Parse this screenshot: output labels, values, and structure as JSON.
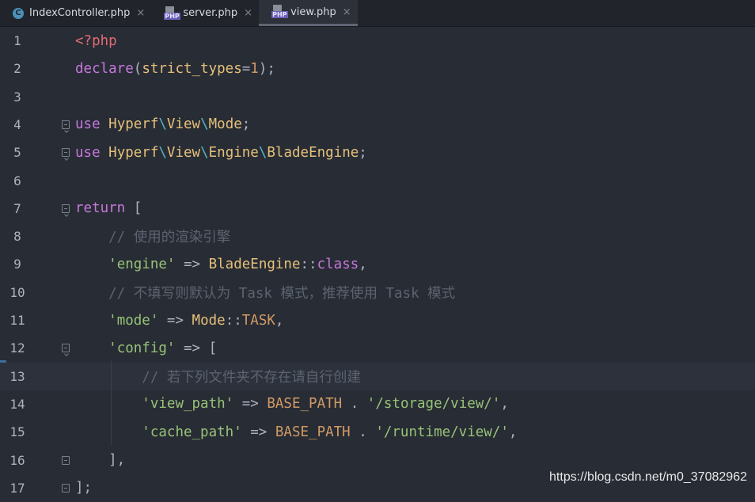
{
  "tabs": [
    {
      "label": "IndexController.php",
      "icon": "class-c-icon",
      "close": "×"
    },
    {
      "label": "server.php",
      "icon": "php-file-icon",
      "close": "×"
    },
    {
      "label": "view.php",
      "icon": "php-file-icon",
      "close": "×",
      "active": true
    }
  ],
  "php_icon_label": "PHP",
  "class_icon_label": "C",
  "editor": {
    "line_numbers": [
      "1",
      "2",
      "3",
      "4",
      "5",
      "6",
      "7",
      "8",
      "9",
      "10",
      "11",
      "12",
      "13",
      "14",
      "15",
      "16",
      "17"
    ],
    "lines": [
      [
        {
          "t": "<?php",
          "c": "ph"
        }
      ],
      [
        {
          "t": "declare",
          "c": "kw"
        },
        {
          "t": "(",
          "c": "op"
        },
        {
          "t": "strict_types",
          "c": "ns"
        },
        {
          "t": "=",
          "c": "op"
        },
        {
          "t": "1",
          "c": "const"
        },
        {
          "t": ");",
          "c": "op"
        }
      ],
      [],
      [
        {
          "t": "use ",
          "c": "kw"
        },
        {
          "t": "Hyperf",
          "c": "ns"
        },
        {
          "t": "\\",
          "c": "sep"
        },
        {
          "t": "View",
          "c": "ns"
        },
        {
          "t": "\\",
          "c": "sep"
        },
        {
          "t": "Mode",
          "c": "ns"
        },
        {
          "t": ";",
          "c": "op"
        }
      ],
      [
        {
          "t": "use ",
          "c": "kw"
        },
        {
          "t": "Hyperf",
          "c": "ns"
        },
        {
          "t": "\\",
          "c": "sep"
        },
        {
          "t": "View",
          "c": "ns"
        },
        {
          "t": "\\",
          "c": "sep"
        },
        {
          "t": "Engine",
          "c": "ns"
        },
        {
          "t": "\\",
          "c": "sep"
        },
        {
          "t": "BladeEngine",
          "c": "ns"
        },
        {
          "t": ";",
          "c": "op"
        }
      ],
      [],
      [
        {
          "t": "return ",
          "c": "kw"
        },
        {
          "t": "[",
          "c": "op"
        }
      ],
      [
        {
          "t": "    // 使用的渲染引擎",
          "c": "cm"
        }
      ],
      [
        {
          "t": "    ",
          "c": "op"
        },
        {
          "t": "'engine'",
          "c": "str"
        },
        {
          "t": " => ",
          "c": "op"
        },
        {
          "t": "BladeEngine",
          "c": "ns"
        },
        {
          "t": "::",
          "c": "op"
        },
        {
          "t": "class",
          "c": "kw"
        },
        {
          "t": ",",
          "c": "op"
        }
      ],
      [
        {
          "t": "    // 不填写则默认为 Task 模式，推荐使用 Task 模式",
          "c": "cm"
        }
      ],
      [
        {
          "t": "    ",
          "c": "op"
        },
        {
          "t": "'mode'",
          "c": "str"
        },
        {
          "t": " => ",
          "c": "op"
        },
        {
          "t": "Mode",
          "c": "ns"
        },
        {
          "t": "::",
          "c": "op"
        },
        {
          "t": "TASK",
          "c": "const"
        },
        {
          "t": ",",
          "c": "op"
        }
      ],
      [
        {
          "t": "    ",
          "c": "op"
        },
        {
          "t": "'config'",
          "c": "str"
        },
        {
          "t": " => [",
          "c": "op"
        }
      ],
      [
        {
          "t": "        // 若下列文件夹不存在请自行创建",
          "c": "cm"
        }
      ],
      [
        {
          "t": "        ",
          "c": "op"
        },
        {
          "t": "'view_path'",
          "c": "str"
        },
        {
          "t": " => ",
          "c": "op"
        },
        {
          "t": "BASE_PATH",
          "c": "const"
        },
        {
          "t": " . ",
          "c": "op"
        },
        {
          "t": "'/storage/view/'",
          "c": "str"
        },
        {
          "t": ",",
          "c": "op"
        }
      ],
      [
        {
          "t": "        ",
          "c": "op"
        },
        {
          "t": "'cache_path'",
          "c": "str"
        },
        {
          "t": " => ",
          "c": "op"
        },
        {
          "t": "BASE_PATH",
          "c": "const"
        },
        {
          "t": " . ",
          "c": "op"
        },
        {
          "t": "'/runtime/view/'",
          "c": "str"
        },
        {
          "t": ",",
          "c": "op"
        }
      ],
      [
        {
          "t": "    ],",
          "c": "op"
        }
      ],
      [
        {
          "t": "];",
          "c": "op"
        }
      ]
    ]
  },
  "watermark": "https://blog.csdn.net/m0_37082962"
}
